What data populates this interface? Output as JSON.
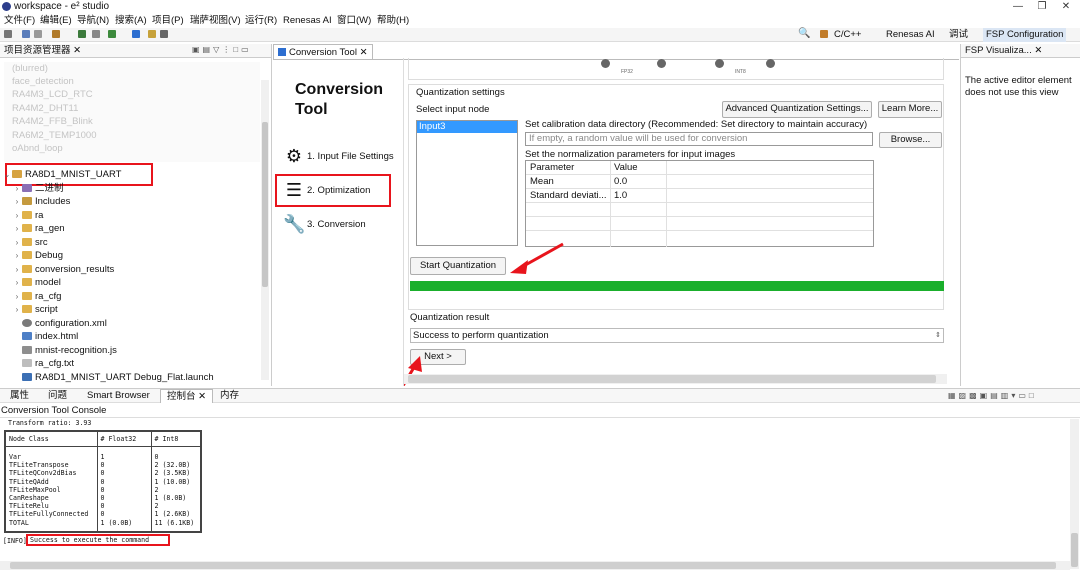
{
  "window": {
    "title": "workspace - e² studio"
  },
  "menu": [
    "文件(F)",
    "编辑(E)",
    "导航(N)",
    "搜索(A)",
    "项目(P)",
    "瑞萨视图(V)",
    "运行(R)",
    "Renesas AI",
    "窗口(W)",
    "帮助(H)"
  ],
  "perspectives": [
    "C/C++",
    "Renesas AI",
    "调试",
    "FSP Configuration"
  ],
  "project_explorer": {
    "tab": "项目资源管理器",
    "blurred_items": [
      "(blurred)",
      "face_detection",
      "RA4M3_LCD_RTC",
      "RA4M2_DHT11",
      "RA4M2_FFB_Blink",
      "RA6M2_TEMP1000",
      "oAbnd_loop"
    ],
    "root": "RA8D1_MNIST_UART",
    "children": [
      "二进制",
      "Includes",
      "ra",
      "ra_gen",
      "src",
      "Debug",
      "conversion_results",
      "model",
      "ra_cfg",
      "script",
      "configuration.xml",
      "index.html",
      "mnist-recognition.js",
      "ra_cfg.txt",
      "RA8D1_MNIST_UART Debug_Flat.launch"
    ]
  },
  "editor": {
    "tab": "Conversion Tool",
    "title_line1": "Conversion",
    "title_line2": "Tool",
    "steps": [
      "1. Input File Settings",
      "2. Optimization",
      "3. Conversion"
    ],
    "chart_labels": [
      "FP32",
      "INT8"
    ],
    "quant": {
      "section": "Quantization settings",
      "select_input_node": "Select input node",
      "advanced_button": "Advanced Quantization Settings...",
      "learn_more_button": "Learn More...",
      "input_node": "Input3",
      "calib_label": "Set calibration data directory (Recommended: Set directory to maintain accuracy)",
      "calib_placeholder": "If empty, a random value will be used for conversion",
      "browse_button": "Browse...",
      "norm_label": "Set the normalization parameters for input images",
      "norm_headers": [
        "Parameter",
        "Value"
      ],
      "norm_rows": [
        {
          "param": "Mean",
          "value": "0.0"
        },
        {
          "param": "Standard deviati...",
          "value": "1.0"
        }
      ],
      "start_button": "Start Quantization",
      "progress": 1.0,
      "result_label": "Quantization result",
      "result_value": "Success to perform quantization",
      "next_button": "Next >"
    }
  },
  "fsp": {
    "tab": "FSP Visualiza...",
    "message": "The active editor element does not use this view"
  },
  "console": {
    "tabs": [
      "属性",
      "问题",
      "Smart Browser",
      "控制台",
      "内存"
    ],
    "title": "Conversion Tool Console",
    "transform": "Transform ratio: 3.93",
    "table_headers": [
      "Node Class",
      "# Float32",
      "# Int8"
    ],
    "table_rows": [
      [
        "Var",
        "1",
        "0"
      ],
      [
        "TFLiteTranspose",
        "0",
        "2 (32.0B)"
      ],
      [
        "TFLiteQConv2dBias",
        "0",
        "2 (3.5KB)"
      ],
      [
        "TFLiteQAdd",
        "0",
        "1 (10.0B)"
      ],
      [
        "TFLiteMaxPool",
        "0",
        "2"
      ],
      [
        "CanReshape",
        "0",
        "1 (8.0B)"
      ],
      [
        "TFLiteRelu",
        "0",
        "2"
      ],
      [
        "TFLiteFullyConnected",
        "0",
        "1 (2.6KB)"
      ],
      [
        "TOTAL",
        "1 (0.0B)",
        "11 (6.1KB)"
      ]
    ],
    "info_prefix": "[INFO]",
    "info_msg": "Success to execute the command"
  },
  "colors": {
    "progress": "#1aaf2c",
    "highlight": "#e8141c",
    "selection": "#3399ff",
    "active_persp": "#dbe6f4"
  }
}
